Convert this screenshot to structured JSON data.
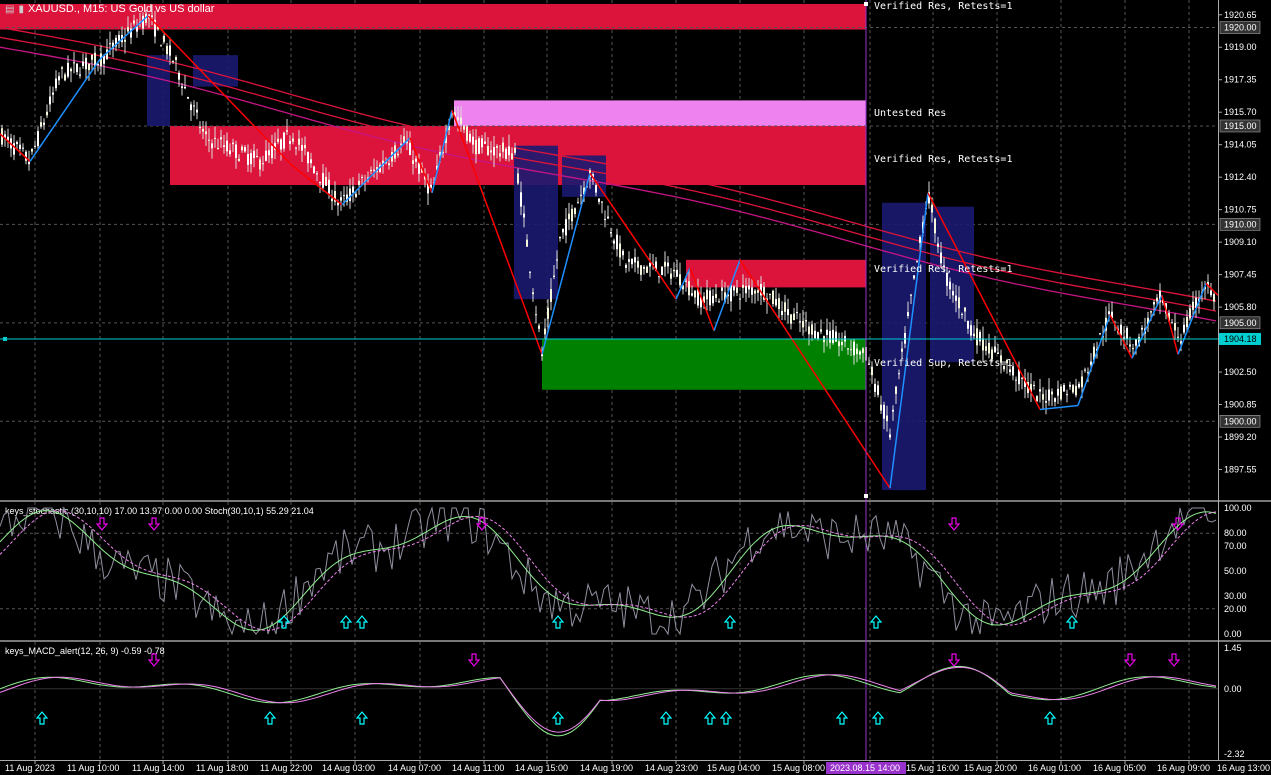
{
  "header": {
    "symbol_text": "XAUUSD., M15:  US Gold vs US dollar",
    "icons": [
      "table-icon",
      "bars-icon"
    ]
  },
  "colors": {
    "background": "#000000",
    "grid": "#555555",
    "zone_verified_res": "#dc143c",
    "zone_untested_res": "#ee82ee",
    "zone_verified_sup": "#008000",
    "zigzag_blue": "#1e90ff",
    "zigzag_red": "#ff0000",
    "ma_red": "#dc143c",
    "ma_magenta": "#c71585",
    "bid_line": "#00ced1",
    "vertical_marker": "#9932cc",
    "osc_main": "#9090a0",
    "osc_signal": "#90ee90",
    "osc_dash": "#ee82ee",
    "arrow_up": "#00ffff",
    "arrow_down": "#ee00ee"
  },
  "price_axis": {
    "labels": [
      "1920.65",
      "1919.00",
      "1917.35",
      "1915.70",
      "1914.05",
      "1912.40",
      "1910.75",
      "1909.10",
      "1907.45",
      "1905.80",
      "1902.50",
      "1900.85",
      "1899.20",
      "1897.55"
    ],
    "boxed_levels": [
      "1920.00",
      "1915.00",
      "1910.00",
      "1905.00",
      "1900.00"
    ],
    "current_price": "1904.18"
  },
  "time_axis": {
    "labels": [
      "11 Aug 2023",
      "11 Aug 10:00",
      "11 Aug 14:00",
      "11 Aug 18:00",
      "11 Aug 22:00",
      "14 Aug 03:00",
      "14 Aug 07:00",
      "14 Aug 11:00",
      "14 Aug 15:00",
      "14 Aug 19:00",
      "14 Aug 23:00",
      "15 Aug 04:00",
      "15 Aug 08:00",
      "15 Aug 16:00",
      "15 Aug 20:00",
      "16 Aug 01:00",
      "16 Aug 05:00",
      "16 Aug 09:00",
      "16 Aug 13:00"
    ],
    "highlight_label": "2023.08.15 14:00"
  },
  "zones": [
    {
      "label": "Verified Res, Retests=1",
      "kind": "verified_res",
      "from": 1919.9,
      "to": 1921.2
    },
    {
      "label": "Untested Res",
      "kind": "untested_res",
      "from": 1914.9,
      "to": 1916.3
    },
    {
      "label": "Verified Res, Retests=1",
      "kind": "verified_res",
      "from": 1912.0,
      "to": 1915.0
    },
    {
      "label": "Verified Res, Retests=1",
      "kind": "verified_res",
      "from": 1906.8,
      "to": 1908.2
    },
    {
      "label": "Verified Sup, Retests=1",
      "kind": "verified_sup",
      "from": 1901.6,
      "to": 1904.2
    }
  ],
  "stochastic": {
    "legend": "keys_stochastic (30,10,10) 17.00 13.97 0.00 0.00 Stoch(30,10,1) 55.29 21.04",
    "axis_labels": [
      "100.00",
      "80.00",
      "70.00",
      "50.00",
      "30.00",
      "20.00",
      "0.00"
    ],
    "up_arrows": 7,
    "down_arrows": 5
  },
  "macd": {
    "legend": "keys_MACD_alert(12, 26, 9) -0.59 -0.78",
    "axis_labels": [
      "1.45",
      "0.00",
      "-2.32"
    ],
    "up_arrows": 10,
    "down_arrows": 5
  }
}
